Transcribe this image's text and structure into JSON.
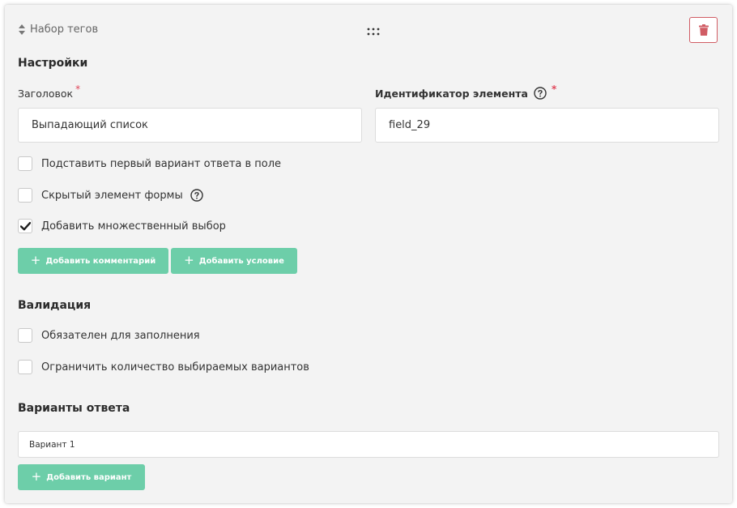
{
  "header": {
    "element_type": "Набор тегов",
    "sort_icon": "sort-icon",
    "drag_icon": "drag-handle-icon",
    "delete_icon": "trash-icon"
  },
  "settings": {
    "heading": "Настройки",
    "title_field": {
      "label": "Заголовок",
      "required_mark": "*",
      "value": "Выпадающий список"
    },
    "id_field": {
      "label": "Идентификатор элемента",
      "required_mark": "*",
      "value": "field_29",
      "help_icon": "question-circle-icon"
    },
    "checkboxes": [
      {
        "label": "Подставить первый вариант ответа в поле",
        "checked": false
      },
      {
        "label": "Скрытый элемент формы",
        "checked": false,
        "help_icon": "question-circle-icon"
      },
      {
        "label": "Добавить множественный выбор",
        "checked": true
      }
    ],
    "add_comment_button": "Добавить комментарий",
    "add_condition_button": "Добавить условие"
  },
  "validation": {
    "heading": "Валидация",
    "checkboxes": [
      {
        "label": "Обязателен для заполнения",
        "checked": false
      },
      {
        "label": "Ограничить количество выбираемых вариантов",
        "checked": false
      }
    ]
  },
  "options": {
    "heading": "Варианты ответа",
    "items": [
      "Вариант 1"
    ],
    "add_option_button": "Добавить вариант"
  },
  "colors": {
    "accent_green": "#6dcea9",
    "danger": "#d05c64",
    "required": "#e0475b",
    "panel_bg": "#f3f3f3"
  }
}
